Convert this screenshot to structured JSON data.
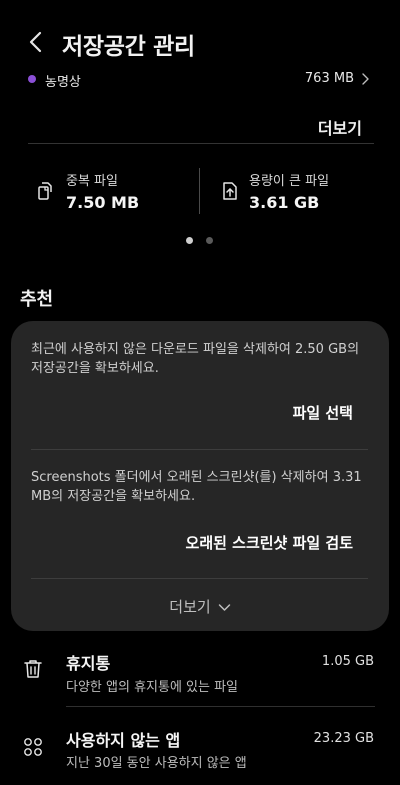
{
  "header": {
    "title": "저장공간 관리"
  },
  "app": {
    "name": "농명상",
    "size": "763 MB"
  },
  "more_label": "더보기",
  "stats": [
    {
      "label": "중복 파일",
      "value": "7.50 MB",
      "icon": "duplicate-files-icon"
    },
    {
      "label": "용량이 큰 파일",
      "value": "3.61 GB",
      "icon": "large-file-icon"
    }
  ],
  "pagination": {
    "total": 2,
    "active": 0
  },
  "recommend": {
    "title": "추천",
    "items": [
      {
        "text": "최근에 사용하지 않은 다운로드 파일을 삭제하여 2.50 GB의 저장공간을 확보하세요.",
        "action": "파일 선택"
      },
      {
        "text": "Screenshots 폴더에서 오래된 스크린샷(를) 삭제하여 3.31 MB의 저장공간을 확보하세요.",
        "action": "오래된 스크린샷 파일 검토"
      }
    ],
    "more": "더보기"
  },
  "list": [
    {
      "title": "휴지통",
      "subtitle": "다양한 앱의 휴지통에 있는 파일",
      "size": "1.05 GB",
      "icon": "trash-icon"
    },
    {
      "title": "사용하지 않는 앱",
      "subtitle": "지난 30일 동안 사용하지 않은 앱",
      "size": "23.23 GB",
      "icon": "apps-grid-icon"
    }
  ],
  "colors": {
    "background": "#000000",
    "card": "#262626",
    "app_dot": "#8b4fd6",
    "page_dot_active": "#cfcfcf",
    "page_dot_inactive": "#5a5a5a"
  }
}
